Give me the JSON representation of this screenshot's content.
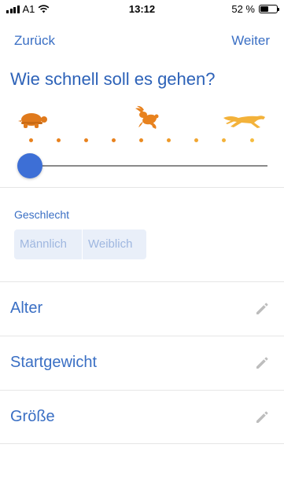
{
  "status_bar": {
    "carrier": "A1",
    "time": "13:12",
    "battery_percent": "52 %",
    "battery_level": 0.52,
    "icons": [
      "signal-icon",
      "wifi-icon",
      "battery-icon"
    ]
  },
  "nav": {
    "back_label": "Zurück",
    "next_label": "Weiter"
  },
  "title": "Wie schnell soll es gehen?",
  "speed": {
    "icons": [
      "turtle-icon",
      "rabbit-icon",
      "cheetah-icon"
    ],
    "dot_colors": [
      "#e8821e",
      "#e8821e",
      "#e8821e",
      "#e8821e",
      "#ea8b22",
      "#ee9a2a",
      "#f1a632",
      "#f3b23a",
      "#f5bc40"
    ],
    "slider_value": 0
  },
  "gender": {
    "label": "Geschlecht",
    "options": [
      "Männlich",
      "Weiblich"
    ]
  },
  "rows": [
    {
      "label": "Alter",
      "icon": "pencil-icon"
    },
    {
      "label": "Startgewicht",
      "icon": "pencil-icon"
    },
    {
      "label": "Größe",
      "icon": "pencil-icon"
    }
  ],
  "colors": {
    "accent": "#3a6fc4",
    "slider_thumb": "#3d6fd6",
    "turtle": "#e07a1c",
    "rabbit": "#e8821e",
    "cheetah": "#f3b23a"
  }
}
